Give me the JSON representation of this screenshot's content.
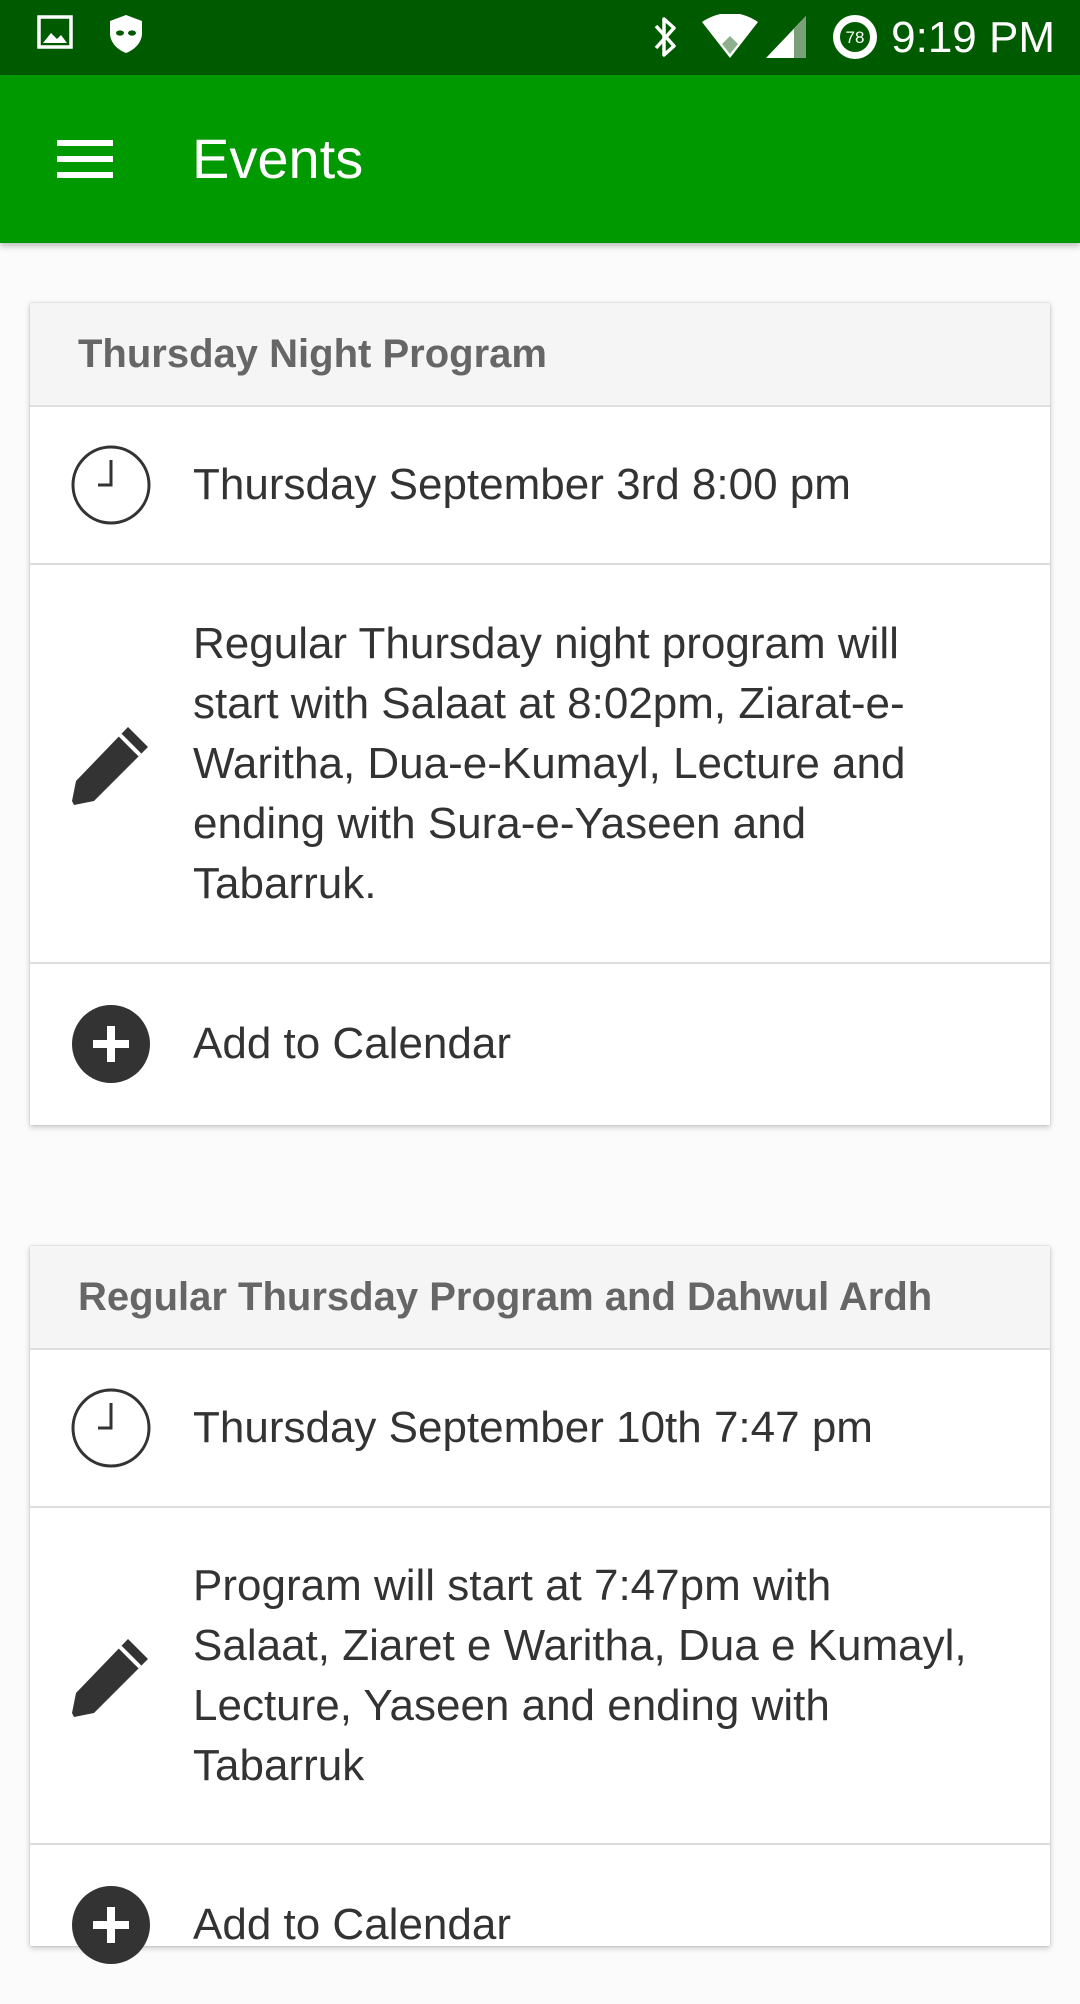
{
  "status_bar": {
    "time": "9:19 PM",
    "battery_level": "78",
    "icons": [
      "image-icon",
      "shield-icon",
      "bluetooth-icon",
      "wifi-icon",
      "cellular-signal-icon",
      "battery-icon"
    ]
  },
  "app_bar": {
    "title": "Events",
    "menu_icon": "hamburger-menu-icon"
  },
  "colors": {
    "status_bar": "#005a00",
    "app_bar": "#009900",
    "card_header_bg": "#f5f5f5",
    "icon": "#333333"
  },
  "events": [
    {
      "title": "Thursday Night Program",
      "datetime": "Thursday September 3rd 8:00 pm",
      "description": "Regular Thursday night program will start with Salaat at 8:02pm, Ziarat-e-Waritha, Dua-e-Kumayl, Lecture and ending with Sura-e-Yaseen and Tabarruk.",
      "add_label": "Add to Calendar"
    },
    {
      "title": "Regular Thursday Program and Dahwul Ardh",
      "datetime": "Thursday September 10th 7:47 pm",
      "description": "Program will start at 7:47pm with Salaat, Ziaret e Waritha, Dua e Kumayl, Lecture, Yaseen and ending with Tabarruk",
      "add_label": "Add to Calendar"
    }
  ]
}
